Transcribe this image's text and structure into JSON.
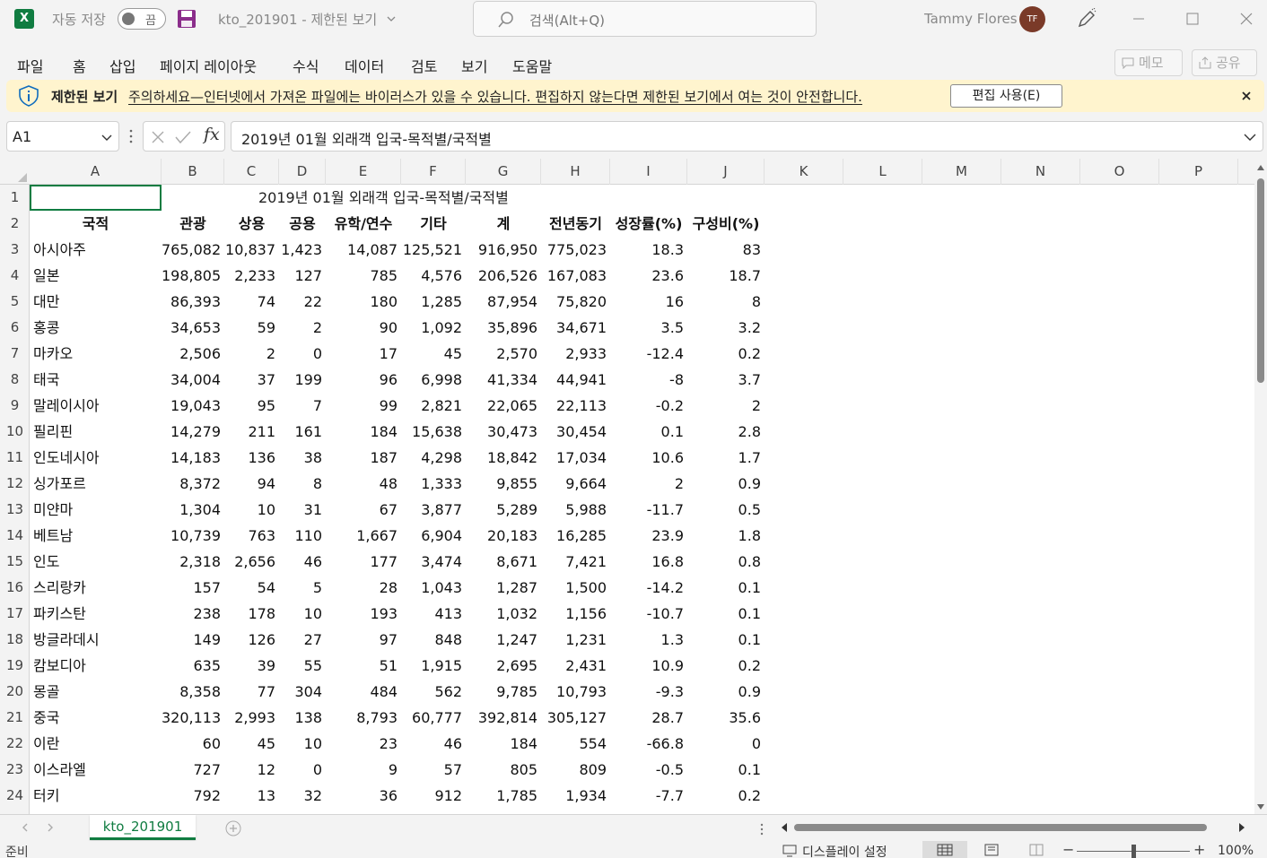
{
  "titlebar": {
    "app_icon": "X",
    "autosave_label": "자동 저장",
    "autosave_state": "끔",
    "doc_title": "kto_201901  -  제한된 보기",
    "search_placeholder": "검색(Alt+Q)",
    "user_name": "Tammy Flores",
    "user_initials": "TF"
  },
  "menu": {
    "items": [
      "파일",
      "홈",
      "삽입",
      "페이지 레이아웃",
      "수식",
      "데이터",
      "검토",
      "보기",
      "도움말"
    ],
    "memo_label": "메모",
    "share_label": "공유"
  },
  "message_bar": {
    "title": "제한된 보기",
    "text": "주의하세요—인터넷에서 가져온 파일에는 바이러스가 있을 수 있습니다. 편집하지 않는다면 제한된 보기에서 여는 것이 안전합니다.",
    "enable_label": "편집 사용(E)",
    "background": "#fff4ce"
  },
  "formula_bar": {
    "name_box": "A1",
    "fx_label": "fx",
    "content": "2019년 01월 외래객 입국-목적별/국적별"
  },
  "sheet": {
    "columns": [
      "A",
      "B",
      "C",
      "D",
      "E",
      "F",
      "G",
      "H",
      "I",
      "J",
      "K",
      "L",
      "M",
      "N",
      "O",
      "P"
    ],
    "title": "2019년 01월 외래객 입국-목적별/국적별",
    "headers": [
      "국적",
      "관광",
      "상용",
      "공용",
      "유학/연수",
      "기타",
      "계",
      "전년동기",
      "성장률(%)",
      "구성비(%)"
    ],
    "rows": [
      [
        "아시아주",
        "765,082",
        "10,837",
        "1,423",
        "14,087",
        "125,521",
        "916,950",
        "775,023",
        "18.3",
        "83"
      ],
      [
        "일본",
        "198,805",
        "2,233",
        "127",
        "785",
        "4,576",
        "206,526",
        "167,083",
        "23.6",
        "18.7"
      ],
      [
        "대만",
        "86,393",
        "74",
        "22",
        "180",
        "1,285",
        "87,954",
        "75,820",
        "16",
        "8"
      ],
      [
        "홍콩",
        "34,653",
        "59",
        "2",
        "90",
        "1,092",
        "35,896",
        "34,671",
        "3.5",
        "3.2"
      ],
      [
        "마카오",
        "2,506",
        "2",
        "0",
        "17",
        "45",
        "2,570",
        "2,933",
        "-12.4",
        "0.2"
      ],
      [
        "태국",
        "34,004",
        "37",
        "199",
        "96",
        "6,998",
        "41,334",
        "44,941",
        "-8",
        "3.7"
      ],
      [
        "말레이시아",
        "19,043",
        "95",
        "7",
        "99",
        "2,821",
        "22,065",
        "22,113",
        "-0.2",
        "2"
      ],
      [
        "필리핀",
        "14,279",
        "211",
        "161",
        "184",
        "15,638",
        "30,473",
        "30,454",
        "0.1",
        "2.8"
      ],
      [
        "인도네시아",
        "14,183",
        "136",
        "38",
        "187",
        "4,298",
        "18,842",
        "17,034",
        "10.6",
        "1.7"
      ],
      [
        "싱가포르",
        "8,372",
        "94",
        "8",
        "48",
        "1,333",
        "9,855",
        "9,664",
        "2",
        "0.9"
      ],
      [
        "미얀마",
        "1,304",
        "10",
        "31",
        "67",
        "3,877",
        "5,289",
        "5,988",
        "-11.7",
        "0.5"
      ],
      [
        "베트남",
        "10,739",
        "763",
        "110",
        "1,667",
        "6,904",
        "20,183",
        "16,285",
        "23.9",
        "1.8"
      ],
      [
        "인도",
        "2,318",
        "2,656",
        "46",
        "177",
        "3,474",
        "8,671",
        "7,421",
        "16.8",
        "0.8"
      ],
      [
        "스리랑카",
        "157",
        "54",
        "5",
        "28",
        "1,043",
        "1,287",
        "1,500",
        "-14.2",
        "0.1"
      ],
      [
        "파키스탄",
        "238",
        "178",
        "10",
        "193",
        "413",
        "1,032",
        "1,156",
        "-10.7",
        "0.1"
      ],
      [
        "방글라데시",
        "149",
        "126",
        "27",
        "97",
        "848",
        "1,247",
        "1,231",
        "1.3",
        "0.1"
      ],
      [
        "캄보디아",
        "635",
        "39",
        "55",
        "51",
        "1,915",
        "2,695",
        "2,431",
        "10.9",
        "0.2"
      ],
      [
        "몽골",
        "8,358",
        "77",
        "304",
        "484",
        "562",
        "9,785",
        "10,793",
        "-9.3",
        "0.9"
      ],
      [
        "중국",
        "320,113",
        "2,993",
        "138",
        "8,793",
        "60,777",
        "392,814",
        "305,127",
        "28.7",
        "35.6"
      ],
      [
        "이란",
        "60",
        "45",
        "10",
        "23",
        "46",
        "184",
        "554",
        "-66.8",
        "0"
      ],
      [
        "이스라엘",
        "727",
        "12",
        "0",
        "9",
        "57",
        "805",
        "809",
        "-0.5",
        "0.1"
      ],
      [
        "터키",
        "792",
        "13",
        "32",
        "36",
        "912",
        "1,785",
        "1,934",
        "-7.7",
        "0.2"
      ]
    ]
  },
  "tabs": {
    "active_sheet": "kto_201901",
    "accent": "#107c41"
  },
  "status": {
    "ready": "준비",
    "display_settings": "디스플레이 설정",
    "zoom": "100%"
  }
}
